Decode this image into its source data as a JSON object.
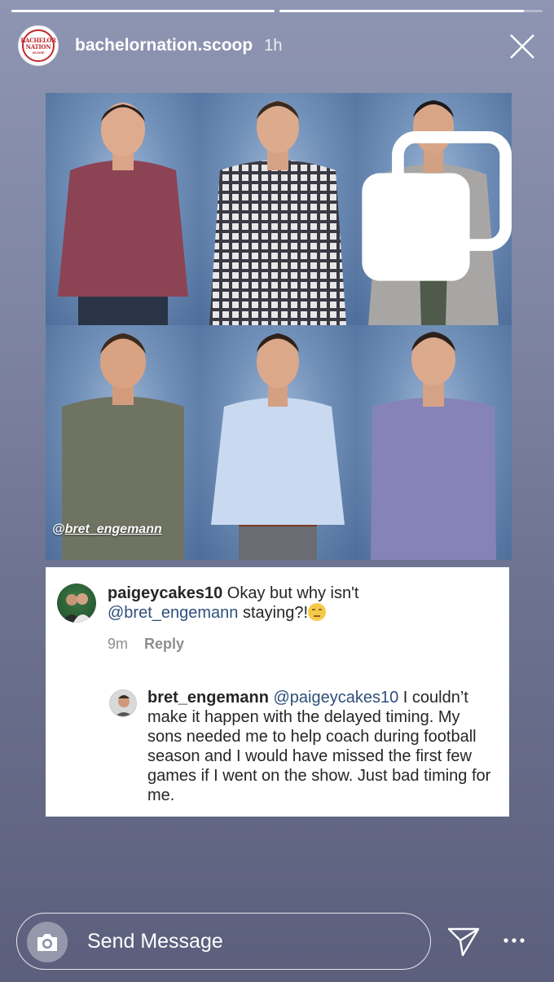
{
  "story": {
    "progress": [
      1.0,
      0.93
    ]
  },
  "header": {
    "avatar_logo_line1": "BACHELOR",
    "avatar_logo_line2": "NATION",
    "avatar_logo_line3": "SCOOP",
    "username": "bachelornation.scoop",
    "time": "1h",
    "close_icon": "close-icon"
  },
  "photo_grid": {
    "mention_prefix": "@",
    "mention_handle": "bret_engemann",
    "multi_icon": "multiple-photos-icon"
  },
  "comment1": {
    "user": "paigeycakes10",
    "text": " Okay but why isn't ",
    "mention": "@bret_engemann",
    "text_end": " staying?!",
    "emoji": "unamused-face-icon",
    "time": "9m",
    "reply_label": "Reply"
  },
  "comment2": {
    "user": "bret_engemann",
    "mention": "@paigeycakes10",
    "text": " I couldn’t make it happen with the delayed timing. My sons needed me to help coach during football season and I would have missed the first few games if I went on the show. Just bad timing for me."
  },
  "composer": {
    "placeholder": "Send Message",
    "camera_icon": "camera-icon",
    "share_icon": "paper-plane-icon",
    "more_icon": "more-icon"
  },
  "colors": {
    "link": "#2f4f7a",
    "logo_red": "#c0282d"
  }
}
